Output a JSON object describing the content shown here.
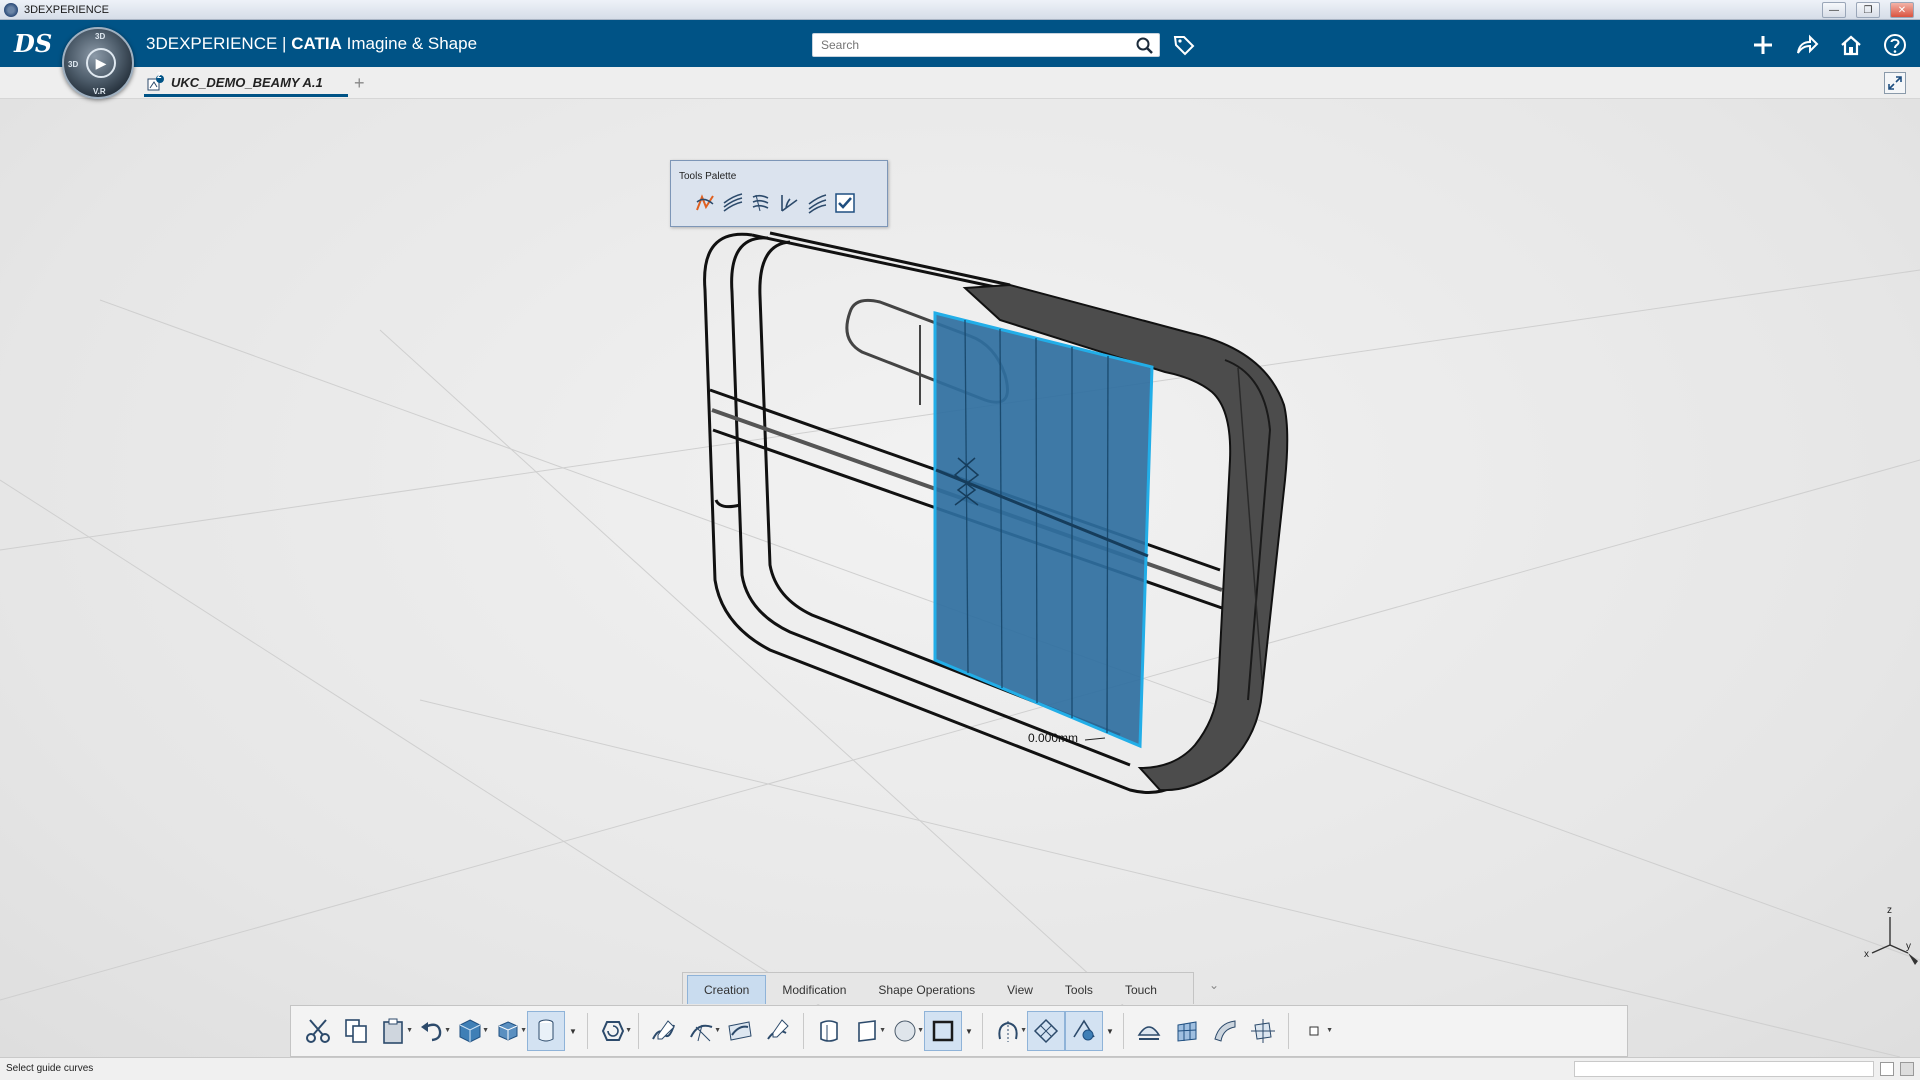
{
  "window": {
    "title": "3DEXPERIENCE"
  },
  "appbar": {
    "brand": "3DEXPERIENCE",
    "separator": " | ",
    "catia": "CATIA",
    "app_name": " Imagine & Shape",
    "compass": {
      "top": "3D",
      "left": "3D",
      "bottom": "V.R"
    },
    "search_placeholder": "Search"
  },
  "tabs": {
    "document": "UKC_DEMO_BEAMY A.1",
    "badge": "2",
    "add": "+"
  },
  "tools_palette": {
    "title": "Tools Palette",
    "icons": [
      "surface-guide-icon",
      "parallel-curves-icon",
      "multi-curves-icon",
      "angle-curves-icon",
      "offset-curves-icon",
      "validate-check-icon"
    ]
  },
  "viewport": {
    "dimension_label": "0.000mm",
    "axis": {
      "z": "z",
      "x": "x",
      "y": "y"
    }
  },
  "command_tabs": [
    {
      "label": "Creation",
      "active": true
    },
    {
      "label": "Modification",
      "active": false
    },
    {
      "label": "Shape Operations",
      "active": false
    },
    {
      "label": "View",
      "active": false
    },
    {
      "label": "Tools",
      "active": false
    },
    {
      "label": "Touch",
      "active": false
    }
  ],
  "status": {
    "text": "Select guide curves"
  },
  "colors": {
    "brand_blue": "#005386",
    "selection_blue": "#2f6f9f",
    "highlight_cyan": "#22aee8"
  }
}
